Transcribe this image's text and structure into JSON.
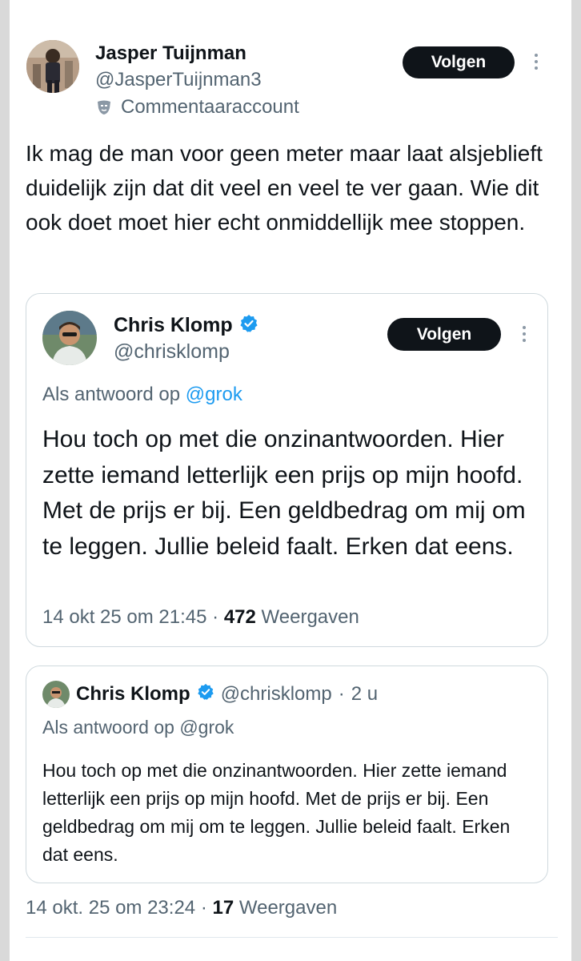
{
  "tweet": {
    "author": {
      "name": "Jasper Tuijnman",
      "handle": "@JasperTuijnman3",
      "label": "Commentaaraccount"
    },
    "follow_label": "Volgen",
    "text": "Ik mag de man voor geen meter maar laat alsjeblieft duidelijk zijn dat dit veel en veel te ver gaan. Wie dit ook doet moet hier echt onmiddellijk mee stoppen.",
    "timestamp": "14 okt. 25 om 23:24",
    "separator": "·",
    "views_count": "17",
    "views_label": "Weergaven"
  },
  "quote1": {
    "author": {
      "name": "Chris Klomp",
      "handle": "@chrisklomp",
      "verified": true
    },
    "follow_label": "Volgen",
    "reply_prefix": "Als antwoord op",
    "reply_to": "@grok",
    "text": "Hou toch op met die onzinantwoorden. Hier zette iemand letterlijk een prijs op mijn hoofd. Met de prijs er bij. Een geldbedrag om mij om te leggen. Jullie beleid faalt. Erken dat eens.",
    "timestamp": "14 okt 25 om 21:45",
    "separator": "·",
    "views_count": "472",
    "views_label": "Weergaven"
  },
  "quote2": {
    "author": {
      "name": "Chris Klomp",
      "handle": "@chrisklomp",
      "verified": true
    },
    "meta_separator": "·",
    "relative_time": "2 u",
    "reply_prefix": "Als antwoord op",
    "reply_to": "@grok",
    "text": "Hou toch op met die onzinantwoorden. Hier zette iemand letterlijk een prijs op mijn hoofd. Met de prijs er bij. Een geldbedrag om mij om te leggen. Jullie beleid faalt. Erken dat eens."
  },
  "icons": {
    "label_icon": "commentary-mask-icon",
    "verified_icon": "verified-badge-icon",
    "more_icon": "more-options-icon"
  },
  "colors": {
    "text": "#0f1419",
    "muted": "#536471",
    "verified": "#1d9bf0",
    "button_bg": "#0f1419",
    "border": "#cfd9de"
  }
}
